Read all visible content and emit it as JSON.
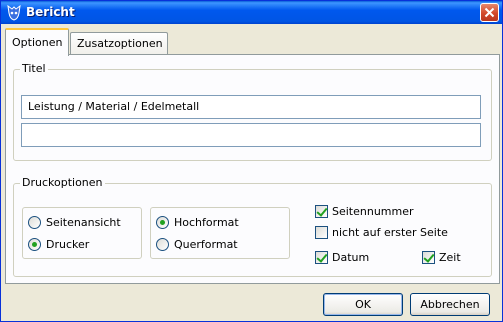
{
  "window": {
    "title": "Bericht"
  },
  "tabs": [
    {
      "label": "Optionen",
      "active": true
    },
    {
      "label": "Zusatzoptionen",
      "active": false
    }
  ],
  "titel_group": {
    "label": "Titel",
    "line1": "Leistung / Material / Edelmetall",
    "line2": ""
  },
  "druck_group": {
    "label": "Druckoptionen",
    "ausgabe": [
      {
        "label": "Seitenansicht",
        "checked": false
      },
      {
        "label": "Drucker",
        "checked": true
      }
    ],
    "format": [
      {
        "label": "Hochformat",
        "checked": true
      },
      {
        "label": "Querformat",
        "checked": false
      }
    ],
    "checkboxes": {
      "seitennummer": {
        "label": "Seitennummer",
        "checked": true
      },
      "nicht_erste": {
        "label": "nicht auf erster Seite",
        "checked": false
      },
      "datum": {
        "label": "Datum",
        "checked": true
      },
      "zeit": {
        "label": "Zeit",
        "checked": true
      }
    }
  },
  "buttons": {
    "ok": "OK",
    "cancel": "Abbrechen"
  },
  "colors": {
    "titlebar": "#0058EE",
    "face": "#ECE9D8",
    "check": "#21A121",
    "tab_hot": "#FFC83C"
  }
}
